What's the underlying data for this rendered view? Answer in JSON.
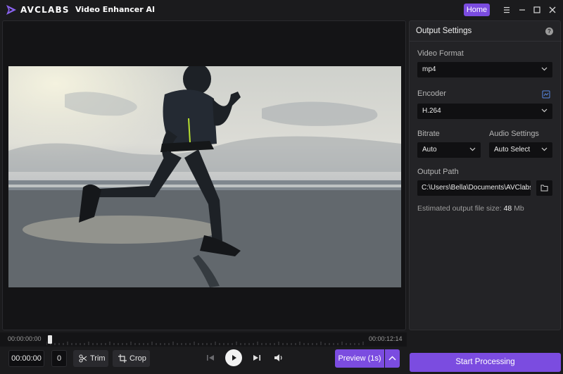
{
  "titlebar": {
    "brand": "AVCLABS",
    "app_name": "Video Enhancer AI",
    "home_label": "Home",
    "icons": [
      "menu-icon",
      "minimize-icon",
      "maximize-icon",
      "close-icon"
    ]
  },
  "timeline": {
    "start_time": "00:00:00:00",
    "end_time": "00:00:12:14",
    "playhead_position": 0.0
  },
  "controls": {
    "current_time": "00:00:00",
    "frame": "0",
    "trim_label": "Trim",
    "crop_label": "Crop",
    "preview_label": "Preview (1s)"
  },
  "output_settings": {
    "title": "Output Settings",
    "video_format": {
      "label": "Video Format",
      "value": "mp4"
    },
    "encoder": {
      "label": "Encoder",
      "value": "H.264"
    },
    "bitrate": {
      "label": "Bitrate",
      "value": "Auto"
    },
    "audio_settings": {
      "label": "Audio Settings",
      "value": "Auto Select"
    },
    "output_path": {
      "label": "Output Path",
      "value": "C:\\Users\\Bella\\Documents\\AVClabs"
    },
    "estimated_size_label": "Estimated output file size:",
    "estimated_size_value": "48",
    "estimated_size_unit": "Mb"
  },
  "start_label": "Start Processing",
  "colors": {
    "accent": "#7b4ce0",
    "background": "#1b1b1d",
    "panel": "#232326"
  }
}
